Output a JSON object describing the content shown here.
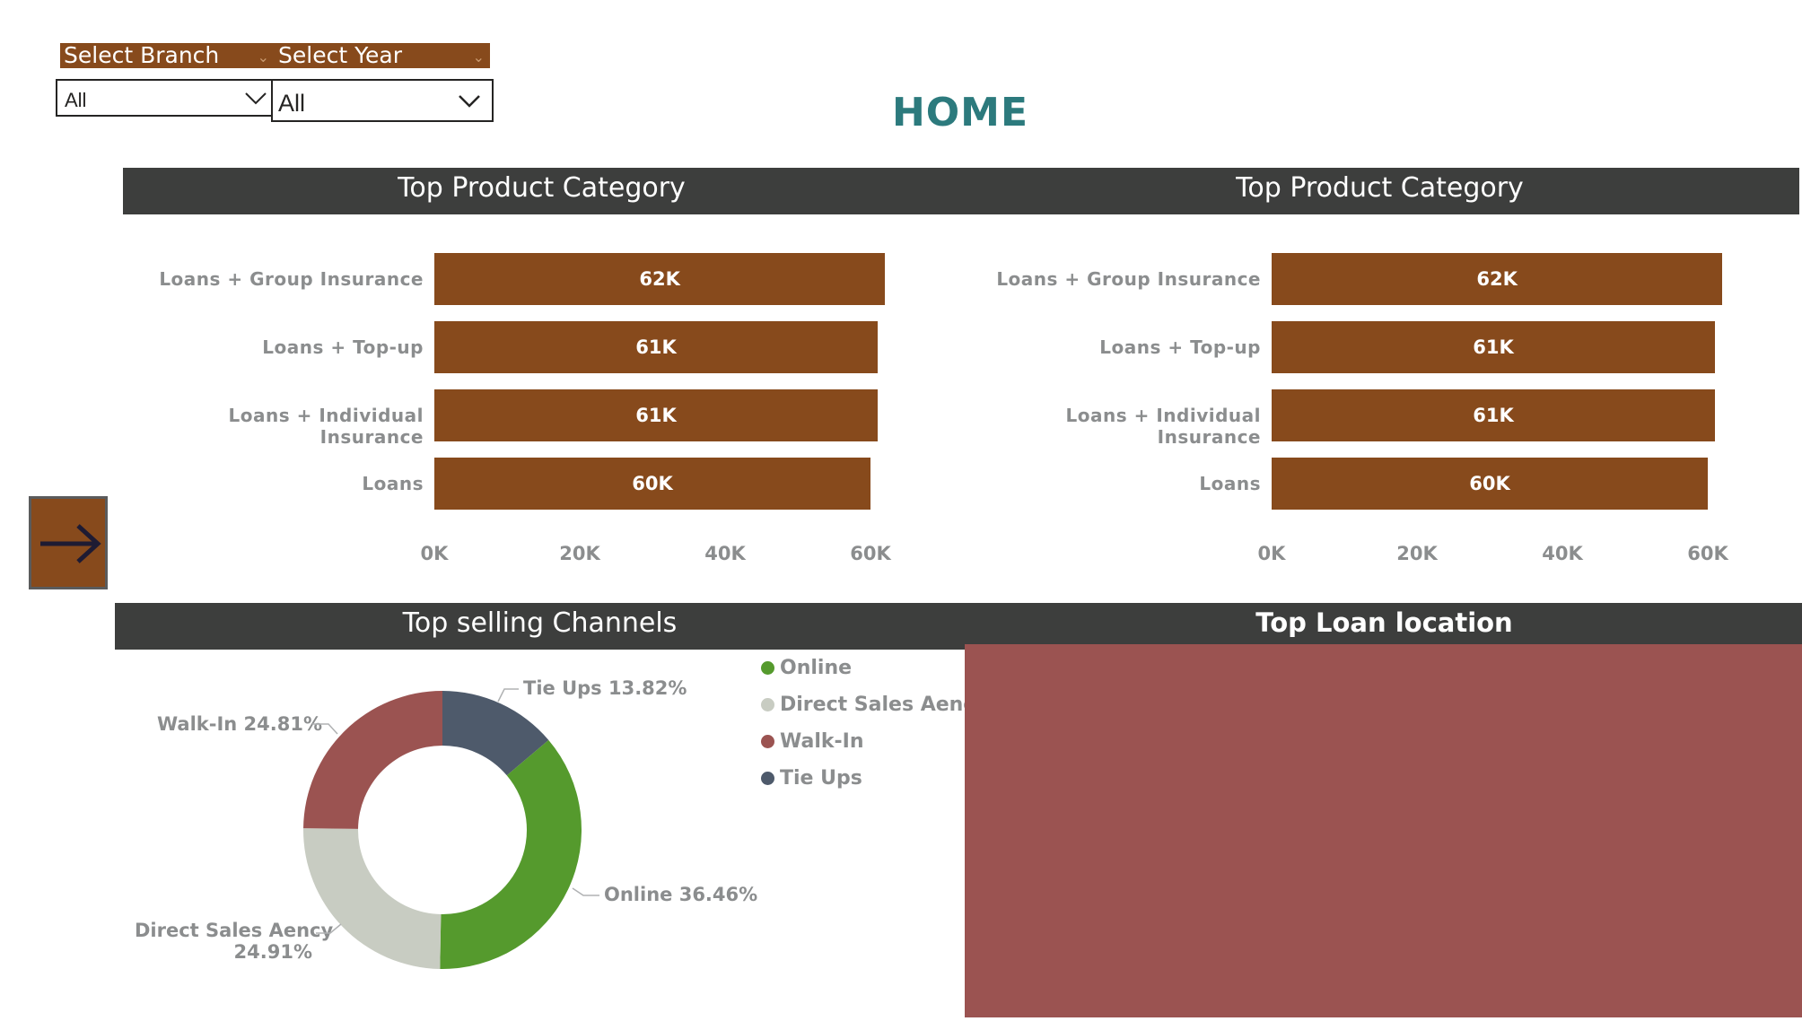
{
  "slicers": {
    "branch": {
      "label": "Select Branch",
      "value": "All"
    },
    "year": {
      "label": "Select Year",
      "value": "All"
    }
  },
  "page_title": "HOME",
  "product_charts": [
    {
      "title": "Top Product Category"
    },
    {
      "title": "Top Product Category"
    }
  ],
  "chart_data": [
    {
      "type": "bar",
      "orientation": "horizontal",
      "title": "Top Product Category",
      "categories": [
        "Loans + Group Insurance",
        "Loans + Top-up",
        "Loans + Individual Insurance",
        "Loans"
      ],
      "values": [
        62000,
        61000,
        61000,
        60000
      ],
      "data_labels": [
        "62K",
        "61K",
        "61K",
        "60K"
      ],
      "x_ticks": [
        "0K",
        "20K",
        "40K",
        "60K"
      ],
      "xlim": [
        0,
        62000
      ],
      "color": "#874a1c"
    },
    {
      "type": "bar",
      "orientation": "horizontal",
      "title": "Top Product Category",
      "categories": [
        "Loans + Group Insurance",
        "Loans + Top-up",
        "Loans + Individual Insurance",
        "Loans"
      ],
      "values": [
        62000,
        61000,
        61000,
        60000
      ],
      "data_labels": [
        "62K",
        "61K",
        "61K",
        "60K"
      ],
      "x_ticks": [
        "0K",
        "20K",
        "40K",
        "60K"
      ],
      "xlim": [
        0,
        62000
      ],
      "color": "#874a1c"
    },
    {
      "type": "pie",
      "variant": "donut",
      "title": "Top selling Channels",
      "slices": [
        {
          "name": "Online",
          "value": 36.46,
          "label": "Online 36.46%",
          "color": "#559a2d"
        },
        {
          "name": "Direct Sales Aency",
          "value": 24.91,
          "label": "Direct Sales Aency 24.91%",
          "color": "#c8ccc2"
        },
        {
          "name": "Walk-In",
          "value": 24.81,
          "label": "Walk-In 24.81%",
          "color": "#9b5351"
        },
        {
          "name": "Tie Ups",
          "value": 13.82,
          "label": "Tie Ups 13.82%",
          "color": "#4e5a6b"
        }
      ],
      "legend": [
        "Online",
        "Direct Sales Aency",
        "Walk-In",
        "Tie Ups"
      ],
      "legend_position": "right"
    }
  ],
  "channels": {
    "title": "Top selling Channels",
    "labels": {
      "tieups": "Tie Ups 13.82%",
      "walkin": "Walk-In 24.81%",
      "online": "Online 36.46%",
      "direct_line1": "Direct Sales Aency",
      "direct_line2": "24.91%"
    },
    "legend": [
      "Online",
      "Direct Sales Aency",
      "Walk-In",
      "Tie Ups"
    ]
  },
  "location": {
    "title": "Top Loan location"
  },
  "nav_button": {
    "icon": "arrow-right-icon"
  }
}
